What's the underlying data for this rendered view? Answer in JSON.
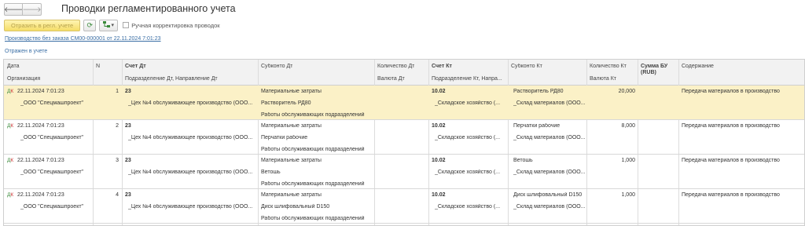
{
  "window": {
    "title": "Проводки регламентированного учета",
    "back_glyph": "🡐",
    "fwd_glyph": "🡒"
  },
  "toolbar": {
    "reflect_label": "Отразить в регл. учете",
    "refresh_glyph": "⟳",
    "more_glyph": "▾",
    "manual_label": "Ручная корректировка проводок"
  },
  "doc_link": "Производство без заказа СМ00-000001 от 22.11.2024 7:01:23",
  "status": "Отражен в учете",
  "columns": {
    "date": "Дата",
    "org": "Организация",
    "n": "N",
    "acc_dt": "Счет Дт",
    "dept_dt": "Подразделение Дт, Направление Дт",
    "sub_dt": "Субконто Дт",
    "qty_dt": "Количество Дт",
    "cur_dt": "Валюта Дт",
    "acc_kt": "Счет Кт",
    "dept_kt": "Подразделение Кт, Напра...",
    "sub_kt": "Субконто Кт",
    "qty_kt": "Количество Кт",
    "cur_kt": "Валюта Кт",
    "sum": "Сумма БУ",
    "sum_unit": "(RUB)",
    "content": "Содержание"
  },
  "rows": [
    {
      "date": "22.11.2024 7:01:23",
      "org": "_ООО \"Спецмашпроект\"",
      "n": "1",
      "acc_dt": "23",
      "dept_dt": "_Цех №4 обслуживающее производство (ООО...",
      "sub_dt1": "Материальные затраты",
      "sub_dt2": "Растворитель РД80",
      "sub_dt3": "Работы обслуживающих подразделений",
      "acc_kt": "10.02",
      "dept_kt": "_Складское хозяйство (...",
      "sub_kt1": "Растворитель РД80",
      "sub_kt2": "_Склад материалов (ООО...",
      "qty_kt": "20,000",
      "content": "Передача материалов в производство"
    },
    {
      "date": "22.11.2024 7:01:23",
      "org": "_ООО \"Спецмашпроект\"",
      "n": "2",
      "acc_dt": "23",
      "dept_dt": "_Цех №4 обслуживающее производство (ООО...",
      "sub_dt1": "Материальные затраты",
      "sub_dt2": "Перчатки рабочие",
      "sub_dt3": "Работы обслуживающих подразделений",
      "acc_kt": "10.02",
      "dept_kt": "_Складское хозяйство (...",
      "sub_kt1": "Перчатки рабочие",
      "sub_kt2": "_Склад материалов (ООО...",
      "qty_kt": "8,000",
      "content": "Передача материалов в производство"
    },
    {
      "date": "22.11.2024 7:01:23",
      "org": "_ООО \"Спецмашпроект\"",
      "n": "3",
      "acc_dt": "23",
      "dept_dt": "_Цех №4 обслуживающее производство (ООО...",
      "sub_dt1": "Материальные затраты",
      "sub_dt2": "Ветошь",
      "sub_dt3": "Работы обслуживающих подразделений",
      "acc_kt": "10.02",
      "dept_kt": "_Складское хозяйство (...",
      "sub_kt1": "Ветошь",
      "sub_kt2": "_Склад материалов (ООО...",
      "qty_kt": "1,000",
      "content": "Передача материалов в производство"
    },
    {
      "date": "22.11.2024 7:01:23",
      "org": "_ООО \"Спецмашпроект\"",
      "n": "4",
      "acc_dt": "23",
      "dept_dt": "_Цех №4 обслуживающее производство (ООО...",
      "sub_dt1": "Материальные затраты",
      "sub_dt2": "Диск шлифовальный D150",
      "sub_dt3": "Работы обслуживающих подразделений",
      "acc_kt": "10.02",
      "dept_kt": "_Складское хозяйство (...",
      "sub_kt1": "Диск шлифовальный D150",
      "sub_kt2": "_Склад материалов (ООО...",
      "qty_kt": "1,000",
      "content": "Передача материалов в производство"
    }
  ]
}
